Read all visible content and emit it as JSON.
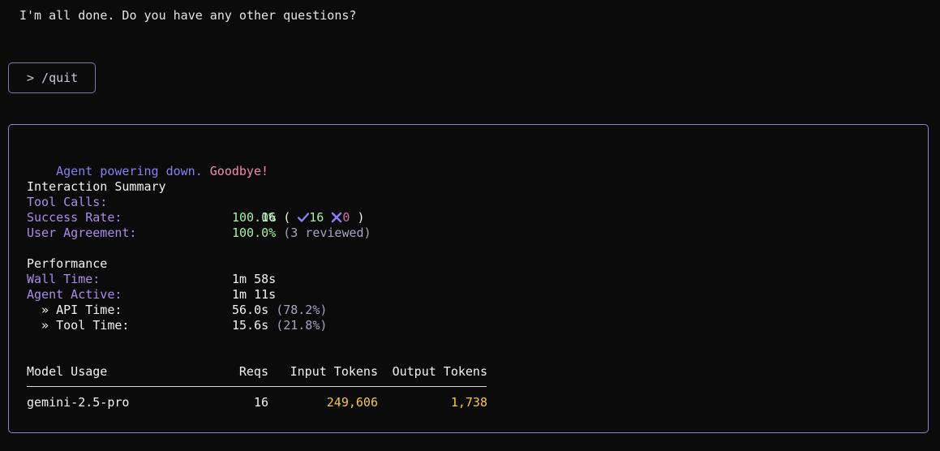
{
  "done_message": "I'm all done. Do you have any other questions?",
  "command": "> /quit",
  "summary": {
    "goodbye_part1": "Agent powering down.",
    "goodbye_part2": "Goodbye!",
    "interaction": {
      "heading": "Interaction Summary",
      "tool_calls_label": "Tool Calls:",
      "tool_calls_total": "16",
      "tool_calls_open": "(",
      "tool_calls_success_icon": "check-icon",
      "tool_calls_success": "16",
      "tool_calls_fail_icon": "x-icon",
      "tool_calls_fail": "0",
      "tool_calls_close": ")",
      "success_rate_label": "Success Rate:",
      "success_rate_value": "100.0%",
      "agreement_label": "User Agreement:",
      "agreement_value": "100.0%",
      "agreement_note": "(3 reviewed)"
    },
    "performance": {
      "heading": "Performance",
      "wall_time_label": "Wall Time:",
      "wall_time_value": "1m 58s",
      "agent_active_label": "Agent Active:",
      "agent_active_value": "1m 11s",
      "api_time_label": "  » API Time:",
      "api_time_value": "56.0s",
      "api_time_pct": "(78.2%)",
      "tool_time_label": "  » Tool Time:",
      "tool_time_value": "15.6s",
      "tool_time_pct": "(21.8%)"
    },
    "model_usage": {
      "headers": {
        "model": "Model Usage",
        "reqs": "Reqs",
        "input": "Input Tokens",
        "output": "Output Tokens"
      },
      "rows": [
        {
          "model": "gemini-2.5-pro",
          "reqs": "16",
          "input": "249,606",
          "output": "1,738"
        }
      ]
    }
  },
  "colors": {
    "background": "#0b0b0c",
    "accent_purple": "#a98ee8",
    "accent_pink": "#f08bb0",
    "success_green": "#a7f0a6",
    "token_yellow": "#f6c945",
    "border": "#8d86c9"
  }
}
